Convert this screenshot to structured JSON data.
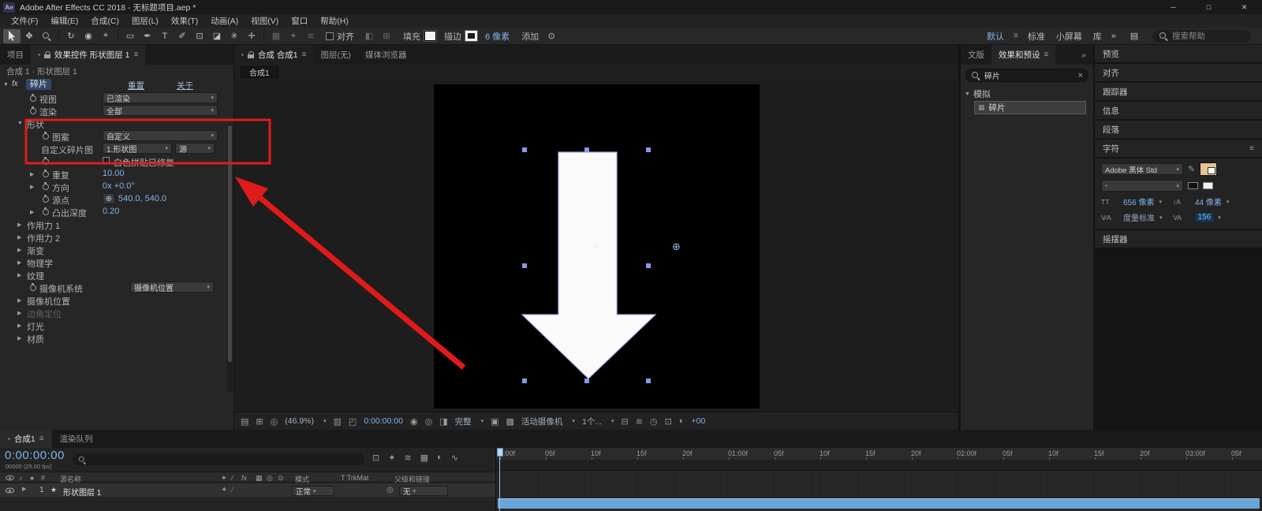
{
  "colors": {
    "accent_blue": "#7db4e8",
    "annotation_red": "#e11b1b",
    "layer_bar_blue": "#68a5d9",
    "selection_handle": "#8b97e8",
    "character_fill_swatch": "#e5c491"
  },
  "icons": {
    "hamburger": "≡",
    "caret": "▾",
    "tri_right": "▶",
    "tri_down": "▼",
    "hand_tool": "✥",
    "rotate_tool": "↻",
    "camera_tool": "◉",
    "pan_behind_tool": "⌖",
    "rect_tool": "▭",
    "pen_tool": "✒",
    "type_tool": "T",
    "brush_tool": "✐",
    "clone_tool": "⊡",
    "eraser_tool": "◪",
    "roto_tool": "✳",
    "puppet_tool": "✛",
    "dim_a": "▦",
    "dim_b": "✦",
    "dim_c": "≋",
    "dim_d": "◧",
    "dim_e": "⊞",
    "ws_icon": "▤",
    "add_circle": "⊙",
    "crosshair": "⊕",
    "anchor": "+",
    "effect_point": "⊕",
    "star": "★",
    "note": "♪",
    "dot": "●",
    "hash": "#",
    "solid_sq": "▪",
    "pickwhip": "◎",
    "slash": "⁄",
    "fx": "fx",
    "view_options": "▤",
    "grid": "⊞",
    "mask_vis": "◎",
    "ruler": "▥",
    "region": "◰",
    "snapshot": "◉",
    "show_snapshot": "◎",
    "channels": "◨",
    "roi": "▣",
    "transparency": "▩",
    "pixel_aspect": "⊟",
    "fast_preview": "≋",
    "timeline_btn": "◷",
    "flowchart": "⊡",
    "exposure_reset": "◐",
    "graph_editor": "∿",
    "frame_blend": "▦",
    "motion_blur": "◐",
    "draft3d": "✦",
    "shy": "≋",
    "fx_item": "▦",
    "eyedropper": "✎",
    "font_size": "TT",
    "leading": "↕A",
    "kerning": "V⁄A",
    "tracking": "VA"
  },
  "titlebar": {
    "app_badge": "Ae",
    "title": "Adobe After Effects CC 2018 - 无标题项目.aep *",
    "minimize": "─",
    "maximize": "□",
    "close": "✕"
  },
  "menubar": {
    "items": [
      "文件(F)",
      "编辑(E)",
      "合成(C)",
      "图层(L)",
      "效果(T)",
      "动画(A)",
      "视图(V)",
      "窗口",
      "帮助(H)"
    ]
  },
  "toolbar": {
    "snap_label": "对齐",
    "fill_label": "填充",
    "stroke_label": "描边",
    "stroke_width": "6 像素",
    "add_label": "添加",
    "workspace_active": "默认",
    "workspace_items": [
      "标准",
      "小屏幕",
      "库"
    ],
    "overflow": "»",
    "search_placeholder": "搜索帮助"
  },
  "effect_controls": {
    "tab_project": "项目",
    "tab_active": "效果控件 形状图层 1",
    "breadcrumb": "合成 1 · 形状图层 1",
    "effect_name": "碎片",
    "reset_label": "重置",
    "about_label": "关于",
    "view_label": "视图",
    "view_value": "已渲染",
    "render_label": "渲染",
    "render_value": "全部",
    "shape_group_label": "形状",
    "pattern_label": "图案",
    "pattern_value": "自定义",
    "custom_map_label": "自定义碎片图",
    "custom_map_value": "1.形状图",
    "source_value": "源",
    "white_tiles_label": "白色拼贴已修复",
    "repeat_label": "重复",
    "repeat_value": "10.00",
    "direction_label": "方向",
    "direction_value": "0x +0.0°",
    "origin_label": "源点",
    "origin_value": "540.0, 540.0",
    "extrude_label": "凸出深度",
    "extrude_value": "0.20",
    "collapsed_groups": [
      "作用力 1",
      "作用力 2",
      "渐变",
      "物理学",
      "纹理"
    ],
    "camera_system_label": "摄像机系统",
    "camera_system_value": "摄像机位置",
    "tail_groups": [
      {
        "label": "摄像机位置",
        "dim": false
      },
      {
        "label": "边角定位",
        "dim": true
      },
      {
        "label": "灯光",
        "dim": false
      },
      {
        "label": "材质",
        "dim": false
      }
    ]
  },
  "viewer": {
    "tab_comp": "合成 合成1",
    "tab_layer": "图层(无)",
    "tab_browser": "媒体浏览器",
    "comp_chip": "合成1",
    "zoom_value": "(46.9%)",
    "timecode": "0:00:00:00",
    "resolution_value": "完整",
    "camera_value": "活动摄像机",
    "view_layout_value": "1个...",
    "exposure_value": "+00"
  },
  "effects_panel": {
    "tab_secondary": "文版",
    "tab_active": "效果和预设",
    "overflow": "»",
    "search_value": "碎片",
    "clear": "×",
    "category_label": "模拟",
    "item_label": "碎片"
  },
  "right_stack": {
    "collapsed_panels": [
      "预览",
      "对齐",
      "跟踪器",
      "信息",
      "段落"
    ],
    "character": {
      "title": "字符",
      "font_family": "Adobe 黑体 Std",
      "font_style": "-",
      "font_size": "656 像素",
      "leading": "44 像素",
      "kerning_value": "度量标准",
      "tracking_value": "156"
    },
    "wiggler": "摇摆器"
  },
  "bottom": {
    "tab_comp": "合成1",
    "tab_queue": "渲染队列",
    "timecode": "0:00:00:00",
    "frame_info": "00000 (25.00 fps)",
    "col_source_name": "源名称",
    "col_mode": "模式",
    "col_trkmat": "T TrkMat",
    "col_parent": "父级和链接",
    "layer_index": "1",
    "layer_name": "形状图层 1",
    "layer_mode": "正常",
    "layer_parent": "无",
    "ruler_labels": [
      "0:00f",
      "05f",
      "10f",
      "15f",
      "20f",
      "01:00f",
      "05f",
      "10f",
      "15f",
      "20f",
      "02:00f",
      "05f",
      "10f",
      "15f",
      "20f",
      "03:00f",
      "05f"
    ]
  }
}
